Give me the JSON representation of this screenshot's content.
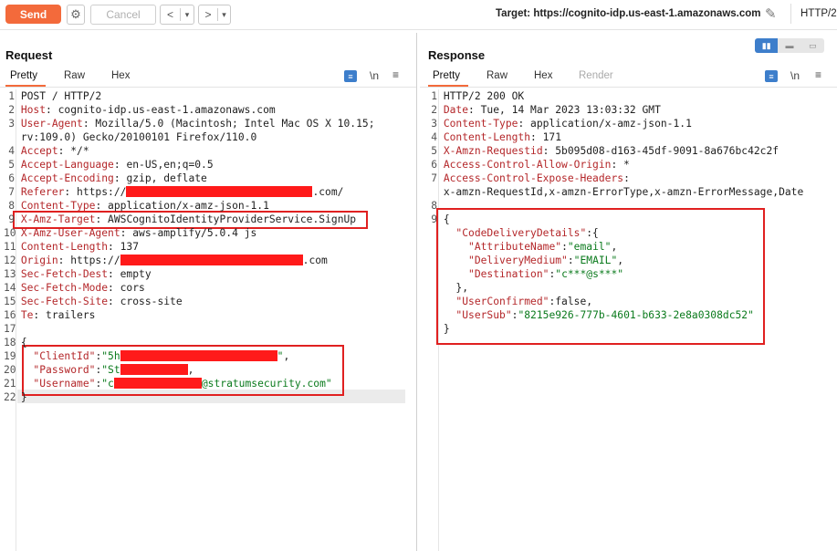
{
  "toolbar": {
    "send_label": "Send",
    "cancel_label": "Cancel",
    "back_label": "<",
    "forward_label": ">",
    "dropdown_glyph": "▾",
    "target_text": "Target: https://cognito-idp.us-east-1.amazonaws.com",
    "http_version": "HTTP/2"
  },
  "request": {
    "title": "Request",
    "tabs": [
      "Pretty",
      "Raw",
      "Hex"
    ],
    "newline_label": "\\n"
  },
  "response": {
    "title": "Response",
    "tabs": [
      "Pretty",
      "Raw",
      "Hex",
      "Render"
    ],
    "newline_label": "\\n"
  },
  "request_lines": [
    {
      "n": "1",
      "parts": [
        [
          "v",
          "POST / HTTP/2"
        ]
      ]
    },
    {
      "n": "2",
      "parts": [
        [
          "k",
          "Host"
        ],
        [
          "v",
          ": cognito-idp.us-east-1.amazonaws.com"
        ]
      ]
    },
    {
      "n": "3",
      "parts": [
        [
          "k",
          "User-Agent"
        ],
        [
          "v",
          ": Mozilla/5.0 (Macintosh; Intel Mac OS X 10.15;"
        ]
      ]
    },
    {
      "n": "",
      "parts": [
        [
          "v",
          "rv:109.0) Gecko/20100101 Firefox/110.0"
        ]
      ]
    },
    {
      "n": "4",
      "parts": [
        [
          "k",
          "Accept"
        ],
        [
          "v",
          ": */*"
        ]
      ]
    },
    {
      "n": "5",
      "parts": [
        [
          "k",
          "Accept-Language"
        ],
        [
          "v",
          ": en-US,en;q=0.5"
        ]
      ]
    },
    {
      "n": "6",
      "parts": [
        [
          "k",
          "Accept-Encoding"
        ],
        [
          "v",
          ": gzip, deflate"
        ]
      ]
    },
    {
      "n": "7",
      "parts": [
        [
          "k",
          "Referer"
        ],
        [
          "v",
          ": https://"
        ],
        [
          "r",
          204
        ],
        [
          "v",
          ".com/"
        ]
      ]
    },
    {
      "n": "8",
      "parts": [
        [
          "k",
          "Content-Type"
        ],
        [
          "v",
          ": application/x-amz-json-1.1"
        ]
      ]
    },
    {
      "n": "9",
      "parts": [
        [
          "k",
          "X-Amz-Target"
        ],
        [
          "v",
          ": AWSCognitoIdentityProviderService.SignUp"
        ]
      ]
    },
    {
      "n": "10",
      "parts": [
        [
          "k",
          "X-Amz-User-Agent"
        ],
        [
          "v",
          ": aws-amplify/5.0.4 js"
        ]
      ]
    },
    {
      "n": "11",
      "parts": [
        [
          "k",
          "Content-Length"
        ],
        [
          "v",
          ": 137"
        ]
      ]
    },
    {
      "n": "12",
      "parts": [
        [
          "k",
          "Origin"
        ],
        [
          "v",
          ": https://"
        ],
        [
          "r",
          200
        ],
        [
          "v",
          ".com"
        ]
      ]
    },
    {
      "n": "13",
      "parts": [
        [
          "k",
          "Sec-Fetch-Dest"
        ],
        [
          "v",
          ": empty"
        ]
      ]
    },
    {
      "n": "14",
      "parts": [
        [
          "k",
          "Sec-Fetch-Mode"
        ],
        [
          "v",
          ": cors"
        ]
      ]
    },
    {
      "n": "15",
      "parts": [
        [
          "k",
          "Sec-Fetch-Site"
        ],
        [
          "v",
          ": cross-site"
        ]
      ]
    },
    {
      "n": "16",
      "parts": [
        [
          "k",
          "Te"
        ],
        [
          "v",
          ": trailers"
        ]
      ]
    },
    {
      "n": "17",
      "parts": []
    },
    {
      "n": "18",
      "parts": [
        [
          "v",
          "{"
        ]
      ]
    },
    {
      "n": "19",
      "parts": [
        [
          "v",
          "  "
        ],
        [
          "k",
          "\"ClientId\""
        ],
        [
          "v",
          ":"
        ],
        [
          "str",
          "\"5h"
        ],
        [
          "r",
          172
        ],
        [
          "str",
          "\""
        ],
        [
          "v",
          ","
        ]
      ]
    },
    {
      "n": "20",
      "parts": [
        [
          "v",
          "  "
        ],
        [
          "k",
          "\"Password\""
        ],
        [
          "v",
          ":"
        ],
        [
          "str",
          "\"St"
        ],
        [
          "r",
          74
        ],
        [
          "v",
          ","
        ]
      ]
    },
    {
      "n": "21",
      "parts": [
        [
          "v",
          "  "
        ],
        [
          "k",
          "\"Username\""
        ],
        [
          "v",
          ":"
        ],
        [
          "str",
          "\"c"
        ],
        [
          "r",
          96
        ],
        [
          "str",
          "@stratumsecurity.com\""
        ]
      ]
    },
    {
      "n": "22",
      "parts": [
        [
          "v",
          "}"
        ]
      ]
    }
  ],
  "response_lines": [
    {
      "n": "1",
      "parts": [
        [
          "v",
          "HTTP/2 200 OK"
        ]
      ]
    },
    {
      "n": "2",
      "parts": [
        [
          "k",
          "Date"
        ],
        [
          "v",
          ": Tue, 14 Mar 2023 13:03:32 GMT"
        ]
      ]
    },
    {
      "n": "3",
      "parts": [
        [
          "k",
          "Content-Type"
        ],
        [
          "v",
          ": application/x-amz-json-1.1"
        ]
      ]
    },
    {
      "n": "4",
      "parts": [
        [
          "k",
          "Content-Length"
        ],
        [
          "v",
          ": 171"
        ]
      ]
    },
    {
      "n": "5",
      "parts": [
        [
          "k",
          "X-Amzn-Requestid"
        ],
        [
          "v",
          ": 5b095d08-d163-45df-9091-8a676bc42c2f"
        ]
      ]
    },
    {
      "n": "6",
      "parts": [
        [
          "k",
          "Access-Control-Allow-Origin"
        ],
        [
          "v",
          ": *"
        ]
      ]
    },
    {
      "n": "7",
      "parts": [
        [
          "k",
          "Access-Control-Expose-Headers"
        ],
        [
          "v",
          ":"
        ]
      ]
    },
    {
      "n": "",
      "parts": [
        [
          "v",
          "x-amzn-RequestId,x-amzn-ErrorType,x-amzn-ErrorMessage,Date"
        ]
      ]
    },
    {
      "n": "8",
      "parts": []
    },
    {
      "n": "9",
      "parts": [
        [
          "v",
          "{"
        ]
      ]
    },
    {
      "n": "",
      "parts": [
        [
          "v",
          "  "
        ],
        [
          "k",
          "\"CodeDeliveryDetails\""
        ],
        [
          "v",
          ":{"
        ]
      ]
    },
    {
      "n": "",
      "parts": [
        [
          "v",
          "    "
        ],
        [
          "k",
          "\"AttributeName\""
        ],
        [
          "v",
          ":"
        ],
        [
          "str",
          "\"email\""
        ],
        [
          "v",
          ","
        ]
      ]
    },
    {
      "n": "",
      "parts": [
        [
          "v",
          "    "
        ],
        [
          "k",
          "\"DeliveryMedium\""
        ],
        [
          "v",
          ":"
        ],
        [
          "str",
          "\"EMAIL\""
        ],
        [
          "v",
          ","
        ]
      ]
    },
    {
      "n": "",
      "parts": [
        [
          "v",
          "    "
        ],
        [
          "k",
          "\"Destination\""
        ],
        [
          "v",
          ":"
        ],
        [
          "str",
          "\"c***@s***\""
        ]
      ]
    },
    {
      "n": "",
      "parts": [
        [
          "v",
          "  },"
        ]
      ]
    },
    {
      "n": "",
      "parts": [
        [
          "v",
          "  "
        ],
        [
          "k",
          "\"UserConfirmed\""
        ],
        [
          "v",
          ":false,"
        ]
      ]
    },
    {
      "n": "",
      "parts": [
        [
          "v",
          "  "
        ],
        [
          "k",
          "\"UserSub\""
        ],
        [
          "v",
          ":"
        ],
        [
          "str",
          "\"8215e926-777b-4601-b633-2e8a0308dc52\""
        ]
      ]
    },
    {
      "n": "",
      "parts": [
        [
          "v",
          "}"
        ]
      ]
    }
  ],
  "colors": {
    "send": "#f36a3b",
    "key": "#b4272a",
    "string": "#0a7a1c",
    "highlight": "#e02020",
    "redaction": "#ff1a1a"
  }
}
